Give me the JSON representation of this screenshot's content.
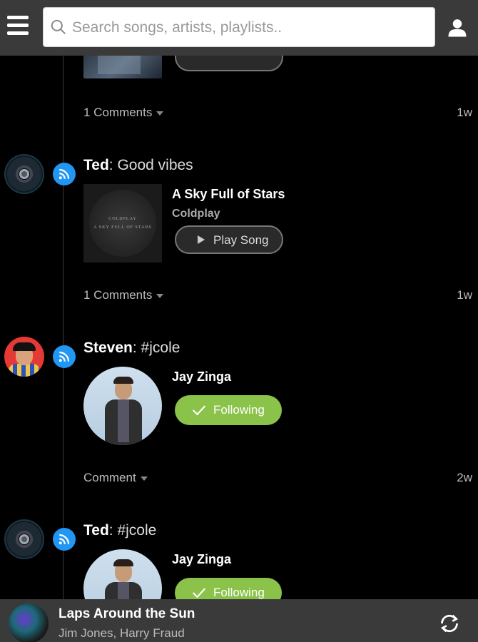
{
  "header": {
    "search_placeholder": "Search songs, artists, playlists.."
  },
  "feed": {
    "partial": {
      "comments": "1 Comments",
      "time": "1w"
    },
    "posts": [
      {
        "user": "Ted",
        "message": ": Good vibes",
        "song_title": "A Sky Full of Stars",
        "song_artist": "Coldplay",
        "album_text_1": "COLDPLAY",
        "album_text_2": "A SKY FULL OF STARS",
        "play_label": "Play Song",
        "comments": "1 Comments",
        "time": "1w"
      },
      {
        "user": "Steven",
        "message": ": #jcole",
        "artist_name": "Jay Zinga",
        "follow_label": "Following",
        "comments": "Comment",
        "time": "2w"
      },
      {
        "user": "Ted",
        "message": ": #jcole",
        "artist_name": "Jay Zinga",
        "follow_label": "Following"
      }
    ]
  },
  "player": {
    "title": "Laps Around the Sun",
    "artist": "Jim Jones, Harry Fraud"
  },
  "colors": {
    "accent_blue": "#2196f3",
    "following_green": "#8bc34a",
    "bar_bg": "#3a3a3a"
  },
  "icons": [
    "menu-icon",
    "search-icon",
    "user-icon",
    "rss-feed-icon",
    "play-icon",
    "check-icon",
    "repeat-icon"
  ]
}
